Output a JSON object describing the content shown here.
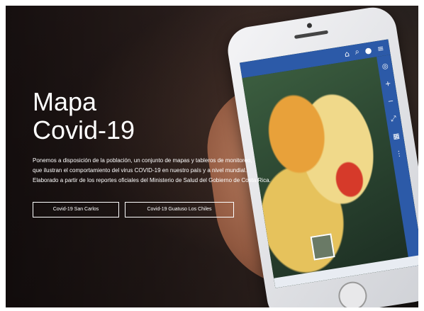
{
  "hero": {
    "title_line1": "Mapa",
    "title_line2": "Covid-19",
    "description_lines": [
      "Ponemos a disposición de la población, un conjunto de mapas y tableros de monitoreo,",
      "que ilustran el comportamiento del virus COVID-19 en nuestro país y a nivel mundial.",
      "Elaborado a partir de los reportes oficiales del Ministerio de Salud del Gobierno de Costa Rica."
    ],
    "buttons": [
      {
        "label": "Covid-19 San Carlos"
      },
      {
        "label": "Covid-19 Guatuso Los Chiles"
      }
    ]
  },
  "phone_app": {
    "appbar_icons": [
      "home-icon",
      "search-icon",
      "user-icon",
      "menu-icon"
    ],
    "side_icons": [
      "locate-icon",
      "zoom-in-icon",
      "zoom-out-icon",
      "expand-icon",
      "layers-icon",
      "scale-icon"
    ]
  },
  "colors": {
    "appbar": "#2c5aa8",
    "map_orange": "#e8a13a",
    "map_red": "#d63a2a",
    "map_yellow": "#f0d98a"
  }
}
